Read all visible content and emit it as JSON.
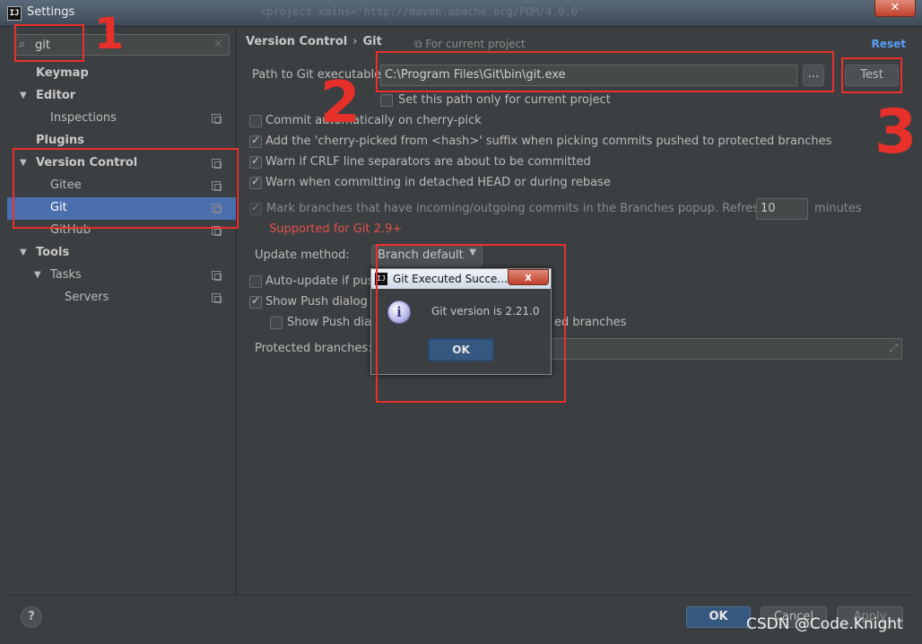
{
  "window": {
    "title": "Settings",
    "background_text": "<project xmlns=\"http://maven.apache.org/POM/4.0.0\""
  },
  "search": {
    "value": "git"
  },
  "tree": {
    "items": [
      {
        "label": "Keymap"
      },
      {
        "label": "Editor"
      },
      {
        "label": "Inspections"
      },
      {
        "label": "Plugins"
      },
      {
        "label": "Version Control"
      },
      {
        "label": "Gitee"
      },
      {
        "label": "Git"
      },
      {
        "label": "GitHub"
      },
      {
        "label": "Tools"
      },
      {
        "label": "Tasks"
      },
      {
        "label": "Servers"
      }
    ],
    "selected": "Git"
  },
  "header": {
    "breadcrumb_parent": "Version Control",
    "breadcrumb_sep": "›",
    "breadcrumb_current": "Git",
    "scope": "For current project",
    "reset": "Reset"
  },
  "path": {
    "label": "Path to Git executable:",
    "value": "C:\\Program Files\\Git\\bin\\git.exe",
    "browse": "...",
    "test": "Test"
  },
  "options": [
    {
      "label": "Set this path only for current project",
      "checked": false
    },
    {
      "label": "Commit automatically on cherry-pick",
      "checked": false
    },
    {
      "label": "Add the 'cherry-picked from <hash>' suffix when picking commits pushed to protected branches",
      "checked": true
    },
    {
      "label": "Warn if CRLF line separators are about to be committed",
      "checked": true
    },
    {
      "label": "Warn when committing in detached HEAD or during rebase",
      "checked": true
    },
    {
      "label": "Mark branches that have incoming/outgoing commits in the Branches popup.  Refresh every",
      "checked": true
    },
    {
      "label": "Auto-update if push",
      "checked": false
    },
    {
      "label": "Show Push dialog fo",
      "checked": true
    },
    {
      "label": "Show Push dialo",
      "checked": false
    }
  ],
  "refresh": {
    "value": "10",
    "unit": "minutes"
  },
  "supported_note": "Supported for Git 2.9+",
  "update_method": {
    "label": "Update method:",
    "value": "Branch default"
  },
  "push_suffix": "ed branches",
  "protected_branches": {
    "label": "Protected branches:"
  },
  "footer": {
    "ok": "OK",
    "cancel": "Cancel",
    "apply": "Apply",
    "help": "?"
  },
  "popup": {
    "title": "Git Executed Succe...",
    "message": "Git version is 2.21.0",
    "ok": "OK",
    "close": "x"
  },
  "annotations": [
    "1",
    "2",
    "3"
  ],
  "watermark": "CSDN @Code.Knight",
  "colors": {
    "selection": "#4b6eaf",
    "link": "#589df6",
    "warning": "#e0534a",
    "annotation": "#e8302a",
    "primary_button": "#365880"
  }
}
